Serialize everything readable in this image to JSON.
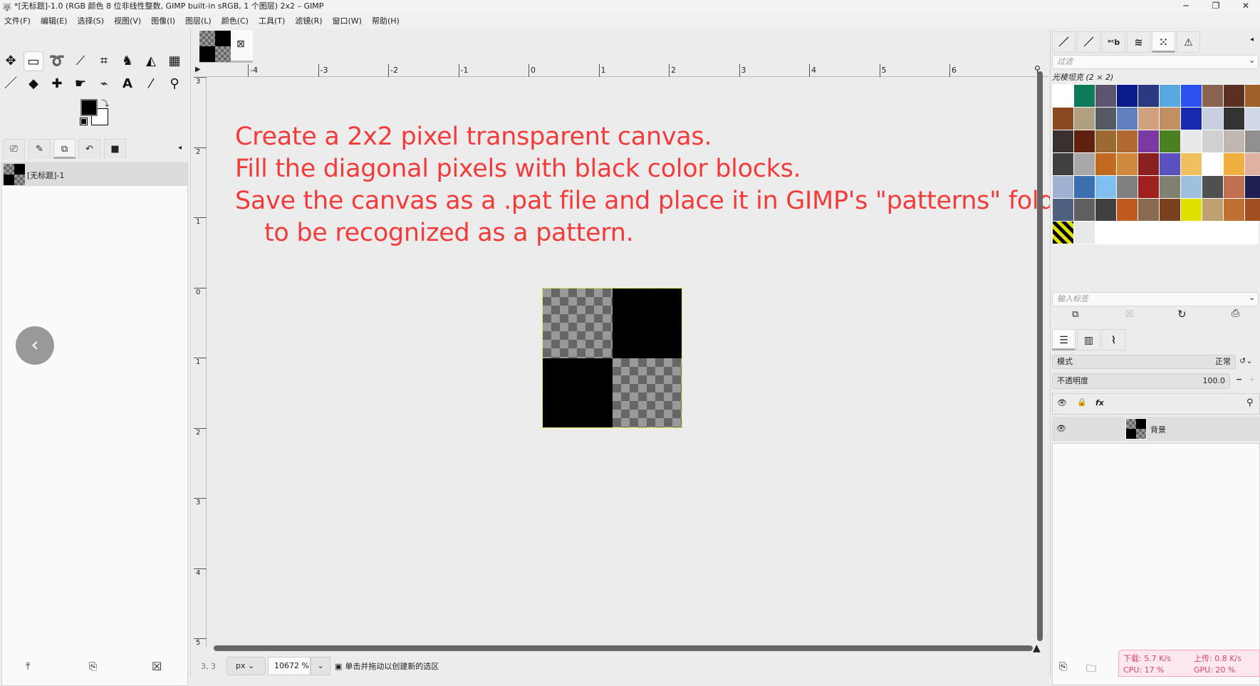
{
  "window": {
    "title": "*[无标题]-1.0 (RGB 颜色 8 位非线性整数, GIMP built-in sRGB, 1 个图层) 2x2 – GIMP",
    "minimize": "─",
    "maximize": "❐",
    "close": "✕"
  },
  "menu": [
    "文件(F)",
    "编辑(E)",
    "选择(S)",
    "视图(V)",
    "图像(I)",
    "图层(L)",
    "颜色(C)",
    "工具(T)",
    "滤镜(R)",
    "窗口(W)",
    "帮助(H)"
  ],
  "toolbox": {
    "tools_row1": [
      "move",
      "rect-select",
      "free-select",
      "fuzzy-select",
      "crop",
      "warp",
      "bucket-fill",
      "gradient"
    ],
    "tools_row2": [
      "paintbrush",
      "eraser",
      "heal",
      "smudge",
      "paths",
      "text",
      "color-picker",
      "zoom"
    ],
    "fg_color": "#000000",
    "bg_color": "#ffffff"
  },
  "images_panel": {
    "item": "[无标题]-1"
  },
  "canvas": {
    "ruler_top": [
      "-4",
      "-3",
      "-2",
      "-1",
      "0",
      "1",
      "2",
      "3",
      "4",
      "5",
      "6"
    ],
    "ruler_left": [
      "3",
      "2",
      "1",
      "0",
      "1",
      "2",
      "3",
      "4",
      "5"
    ],
    "instructions": [
      "Create a 2x2 pixel transparent canvas.",
      "Fill the diagonal pixels with black color blocks.",
      "Save the canvas as a .pat file and place it in GIMP's \"patterns\" folder",
      "to be recognized as a pattern."
    ],
    "instruction_color": "#f23c3c"
  },
  "status": {
    "coords": "3, 3",
    "unit": "px",
    "zoom": "10672 %",
    "message": "单击并拖动以创建新的选区"
  },
  "patterns_panel": {
    "filter_placeholder": "过滤",
    "selected": "光棱坦克 (2 × 2)",
    "tag_placeholder": "输入标签",
    "swatches": [
      "#ffffff",
      "#0e7a5a",
      "#5d5570",
      "#0a1a8a",
      "#2a3a80",
      "#5aa8e0",
      "#2b52f0",
      "#8a6450",
      "#5a3020",
      "#a0602a",
      "#8a4a20",
      "#b0a080",
      "#555a60",
      "#6080c0",
      "#d0a080",
      "#c09060",
      "#1a2ab0",
      "#c8d0e0",
      "#333333",
      "#d0d8e8",
      "#3a3030",
      "#602010",
      "#9a6a30",
      "#b06a30",
      "#7a3aa0",
      "#4a8020",
      "#e8e8e8",
      "#d0d0d0",
      "#c0b8b0",
      "#909090",
      "#404040",
      "#a8a8a8",
      "#c06a20",
      "#d08a40",
      "#8a2020",
      "#5a50c0",
      "#f0c060",
      "#ffffff",
      "#f0b040",
      "#e0b0a0",
      "#a0b0d0",
      "#3a70b0",
      "#80c0f0",
      "#808080",
      "#a02020",
      "#808070",
      "#a0c0e0",
      "#505050",
      "#c07050",
      "#202050",
      "#506080",
      "#606060",
      "#404040",
      "#c05a20",
      "#8a6a50",
      "#7a4020",
      "#e0e000",
      "#c0a070",
      "#c07030",
      "#a05020",
      "#d09050",
      "#e8e8e8"
    ]
  },
  "layers_panel": {
    "mode_label": "模式",
    "mode_value": "正常",
    "opacity_label": "不透明度",
    "opacity_value": "100.0",
    "layer_name": "背景"
  },
  "netmon": {
    "down": "下载: 5.7 K/s",
    "up": "上传: 0.8 K/s",
    "cpu": "CPU: 17 %",
    "gpu": "GPU: 20 %"
  }
}
